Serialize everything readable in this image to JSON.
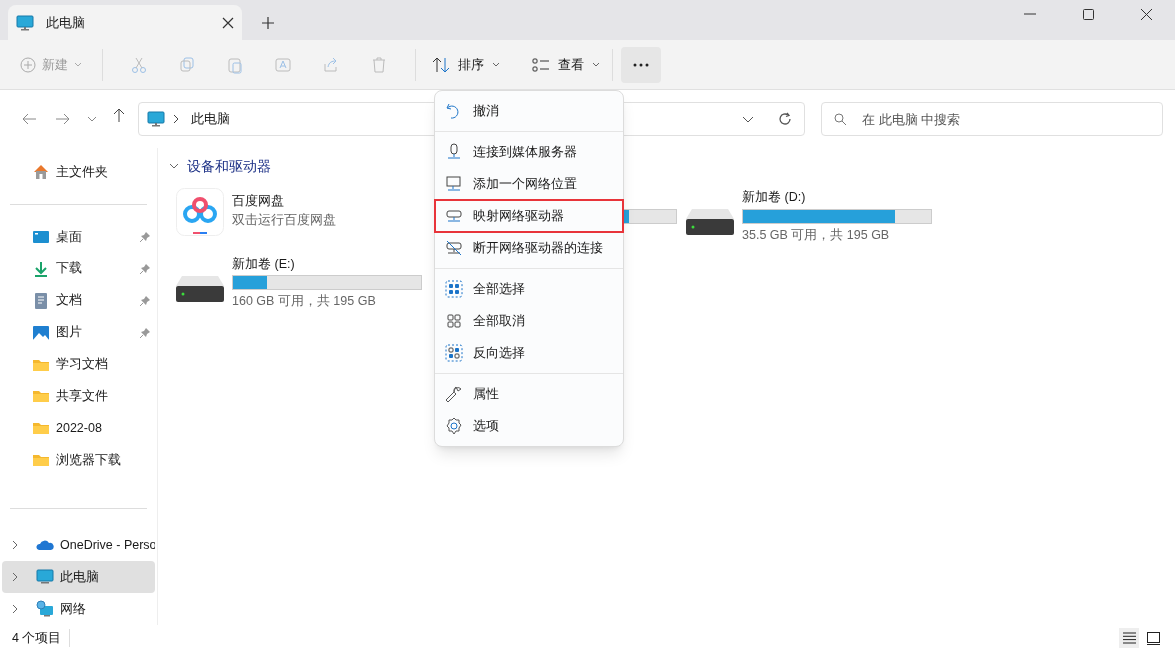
{
  "tabs": [
    {
      "label": "此电脑",
      "selected": true
    }
  ],
  "toolbar": {
    "new_label": "新建",
    "sort_label": "排序",
    "view_label": "查看"
  },
  "address": {
    "path": "此电脑"
  },
  "search": {
    "placeholder": "在 此电脑 中搜索"
  },
  "sidebar": {
    "home": {
      "label": "主文件夹"
    },
    "quick_access": [
      {
        "kind": "desktop",
        "label": "桌面",
        "pinned": true
      },
      {
        "kind": "download",
        "label": "下载",
        "pinned": true
      },
      {
        "kind": "document",
        "label": "文档",
        "pinned": true
      },
      {
        "kind": "picture",
        "label": "图片",
        "pinned": true
      },
      {
        "kind": "folder",
        "label": "学习文档",
        "pinned": false
      },
      {
        "kind": "folder",
        "label": "共享文件",
        "pinned": false
      },
      {
        "kind": "folder",
        "label": "2022-08",
        "pinned": false
      },
      {
        "kind": "folder",
        "label": "浏览器下载",
        "pinned": false
      }
    ],
    "locations": [
      {
        "kind": "cloud",
        "label": "OneDrive - Perso",
        "selected": false
      },
      {
        "kind": "pc",
        "label": "此电脑",
        "selected": true
      },
      {
        "kind": "network",
        "label": "网络",
        "selected": false
      }
    ]
  },
  "section": {
    "title": "设备和驱动器",
    "expanded": true
  },
  "items": [
    {
      "kind": "app",
      "name": "百度网盘",
      "subtitle": "双击运行百度网盘"
    },
    {
      "kind": "covered_drive",
      "level": 0.75
    },
    {
      "kind": "drive",
      "name": "新加卷 (D:)",
      "level": 0.81,
      "usage": "35.5 GB 可用，共 195 GB"
    },
    {
      "kind": "drive",
      "name": "新加卷 (E:)",
      "level": 0.18,
      "usage": "160 GB 可用，共 195 GB"
    }
  ],
  "menu": [
    [
      {
        "kind": "undo",
        "label": "撤消",
        "highlighted": false
      }
    ],
    [
      {
        "kind": "media",
        "label": "连接到媒体服务器",
        "highlighted": false
      },
      {
        "kind": "netloc",
        "label": "添加一个网络位置",
        "highlighted": false
      },
      {
        "kind": "mapdrive",
        "label": "映射网络驱动器",
        "highlighted": true
      },
      {
        "kind": "disconnect",
        "label": "断开网络驱动器的连接",
        "highlighted": false
      }
    ],
    [
      {
        "kind": "selectall",
        "label": "全部选择",
        "highlighted": false
      },
      {
        "kind": "selectnone",
        "label": "全部取消",
        "highlighted": false
      },
      {
        "kind": "invert",
        "label": "反向选择",
        "highlighted": false
      }
    ],
    [
      {
        "kind": "wrench",
        "label": "属性",
        "highlighted": false
      },
      {
        "kind": "gear",
        "label": "选项",
        "highlighted": false
      }
    ]
  ],
  "status_bar": {
    "count": "4 个项目"
  }
}
